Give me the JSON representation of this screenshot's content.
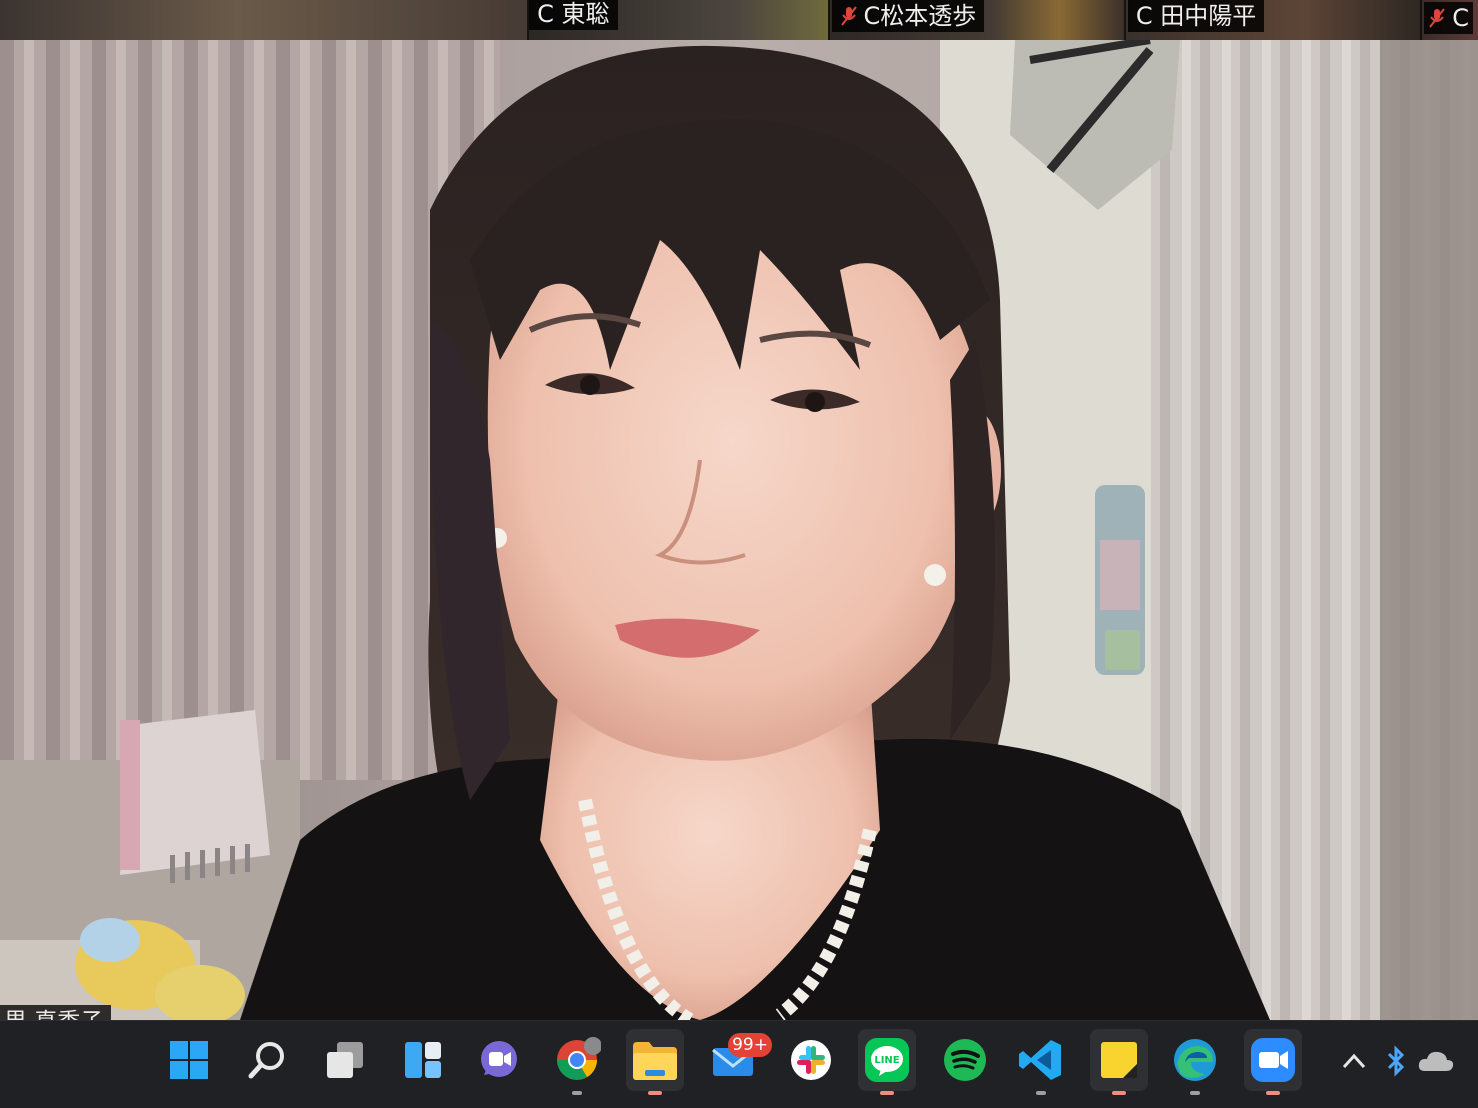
{
  "participants": [
    {
      "name": "",
      "muted": false
    },
    {
      "name": "C 東聡",
      "muted": false
    },
    {
      "name": "C松本透歩",
      "muted": true
    },
    {
      "name": "C 田中陽平",
      "muted": false
    },
    {
      "name": "C",
      "muted": true
    }
  ],
  "main_video": {
    "name_tag": "界 真季子"
  },
  "taskbar": {
    "apps": [
      {
        "name": "Start",
        "icon": "windows-start-icon"
      },
      {
        "name": "Search",
        "icon": "search-icon"
      },
      {
        "name": "Task View",
        "icon": "task-view-icon"
      },
      {
        "name": "Widgets",
        "icon": "widgets-icon"
      },
      {
        "name": "Chat",
        "icon": "teams-chat-icon"
      },
      {
        "name": "Chrome",
        "icon": "chrome-icon"
      },
      {
        "name": "File Explorer",
        "icon": "folder-icon"
      },
      {
        "name": "Mail",
        "icon": "mail-icon"
      },
      {
        "name": "Slack",
        "icon": "slack-icon"
      },
      {
        "name": "LINE",
        "icon": "line-icon"
      },
      {
        "name": "Spotify",
        "icon": "spotify-icon"
      },
      {
        "name": "Visual Studio Code",
        "icon": "vscode-icon"
      },
      {
        "name": "Sticky Notes",
        "icon": "sticky-notes-icon"
      },
      {
        "name": "Edge",
        "icon": "edge-icon"
      },
      {
        "name": "Zoom",
        "icon": "zoom-icon"
      }
    ],
    "mail_badge": "99+",
    "tray": {
      "chevron": "^",
      "bluetooth_icon": "bluetooth-icon",
      "cloud_icon": "onedrive-cloud-icon"
    },
    "line_label": "LINE"
  },
  "colors": {
    "taskbar_bg": "#202124",
    "badge_red": "#e34234",
    "line_green": "#06c755",
    "spotify_green": "#1db954",
    "vscode_blue": "#23a9f2",
    "zoom_blue": "#2d8cff"
  }
}
